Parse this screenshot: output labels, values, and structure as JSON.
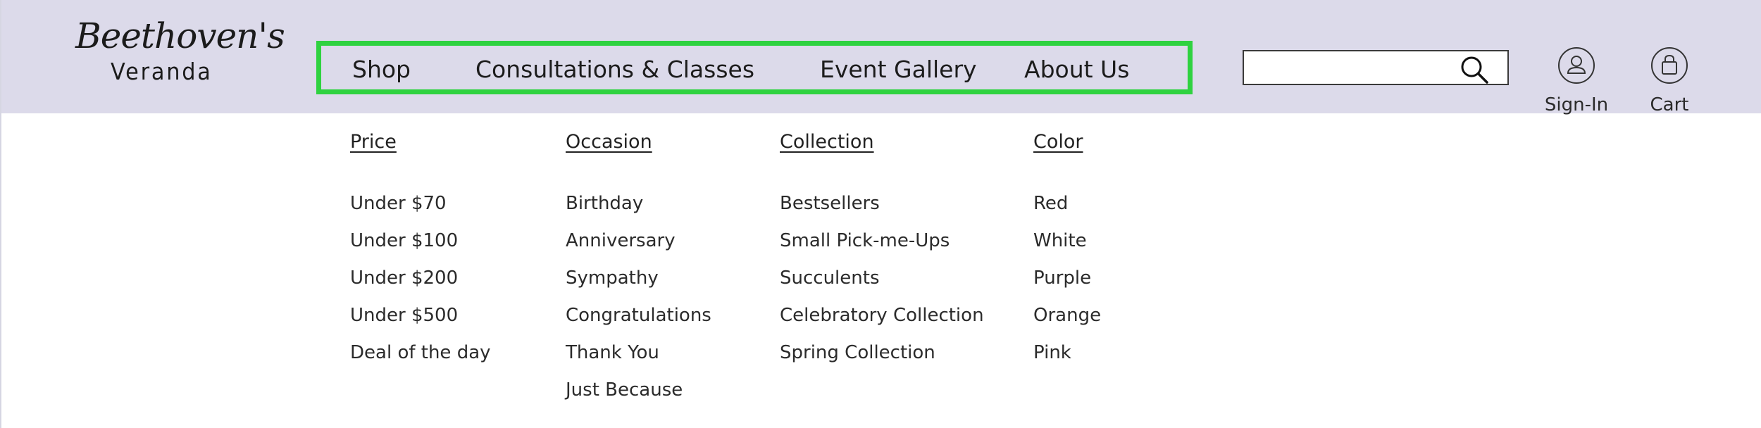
{
  "logo": {
    "script": "Beethoven's",
    "sub": "Veranda"
  },
  "nav": {
    "items": [
      "Shop",
      "Consultations & Classes",
      "Event Gallery",
      "About Us"
    ],
    "highlight_color": "#2fd240"
  },
  "search": {
    "value": "",
    "icon": "search-icon"
  },
  "account": {
    "signin_label": "Sign-In",
    "cart_label": "Cart"
  },
  "menu": {
    "columns": [
      {
        "heading": "Price",
        "items": [
          "Under $70",
          "Under $100",
          "Under $200",
          "Under $500",
          "Deal of the day"
        ]
      },
      {
        "heading": "Occasion",
        "items": [
          "Birthday",
          "Anniversary",
          "Sympathy",
          "Congratulations",
          "Thank You",
          "Just Because"
        ]
      },
      {
        "heading": "Collection",
        "items": [
          "Bestsellers",
          "Small Pick-me-Ups",
          "Succulents",
          "Celebratory Collection",
          "Spring Collection"
        ]
      },
      {
        "heading": "Color",
        "items": [
          "Red",
          "White",
          "Purple",
          "Orange",
          "Pink"
        ]
      }
    ]
  },
  "colors": {
    "header_bg": "#dcdaea",
    "page_bg": "#ffffff"
  }
}
